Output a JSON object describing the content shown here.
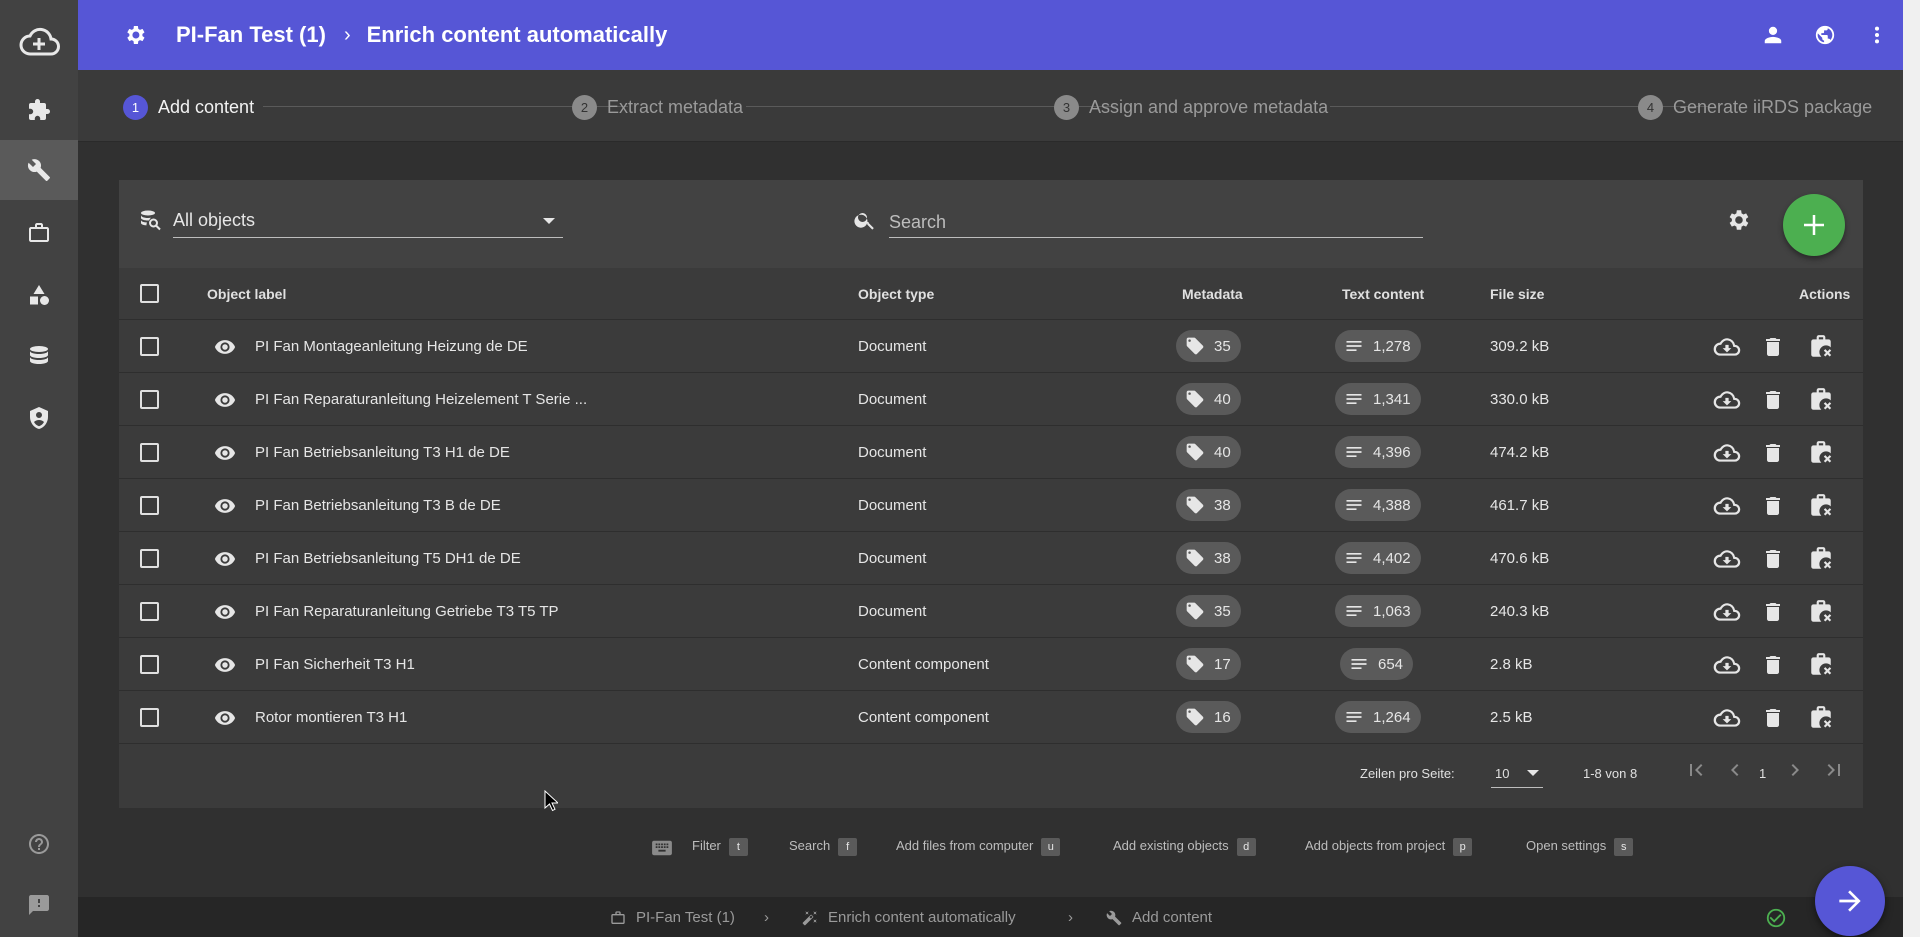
{
  "header": {
    "project": "PI-Fan Test (1)",
    "page": "Enrich content automatically"
  },
  "stepper": [
    {
      "num": "1",
      "label": "Add content",
      "active": true
    },
    {
      "num": "2",
      "label": "Extract metadata",
      "active": false
    },
    {
      "num": "3",
      "label": "Assign and approve metadata",
      "active": false
    },
    {
      "num": "4",
      "label": "Generate iiRDS package",
      "active": false
    }
  ],
  "toolbar": {
    "filter_value": "All objects",
    "search_placeholder": "Search"
  },
  "table": {
    "headers": {
      "label": "Object label",
      "type": "Object type",
      "metadata": "Metadata",
      "text": "Text content",
      "size": "File size",
      "actions": "Actions"
    },
    "rows": [
      {
        "label": "PI Fan Montageanleitung Heizung de DE",
        "type": "Document",
        "metadata": "35",
        "text": "1,278",
        "size": "309.2 kB"
      },
      {
        "label": "PI Fan Reparaturanleitung Heizelement T Serie ...",
        "type": "Document",
        "metadata": "40",
        "text": "1,341",
        "size": "330.0 kB"
      },
      {
        "label": "PI Fan Betriebsanleitung T3 H1 de DE",
        "type": "Document",
        "metadata": "40",
        "text": "4,396",
        "size": "474.2 kB"
      },
      {
        "label": "PI Fan Betriebsanleitung T3 B de DE",
        "type": "Document",
        "metadata": "38",
        "text": "4,388",
        "size": "461.7 kB"
      },
      {
        "label": "PI Fan Betriebsanleitung T5 DH1 de DE",
        "type": "Document",
        "metadata": "38",
        "text": "4,402",
        "size": "470.6 kB"
      },
      {
        "label": "PI Fan Reparaturanleitung Getriebe T3 T5 TP",
        "type": "Document",
        "metadata": "35",
        "text": "1,063",
        "size": "240.3 kB"
      },
      {
        "label": "PI Fan Sicherheit T3 H1",
        "type": "Content component",
        "metadata": "17",
        "text": "654",
        "size": "2.8 kB"
      },
      {
        "label": "Rotor montieren T3 H1",
        "type": "Content component",
        "metadata": "16",
        "text": "1,264",
        "size": "2.5 kB"
      }
    ]
  },
  "pager": {
    "rows_label": "Zeilen pro Seite:",
    "rows_value": "10",
    "range": "1-8 von 8",
    "page": "1"
  },
  "hints": [
    {
      "label": "Filter",
      "key": "t"
    },
    {
      "label": "Search",
      "key": "f"
    },
    {
      "label": "Add files from computer",
      "key": "u"
    },
    {
      "label": "Add existing objects",
      "key": "d"
    },
    {
      "label": "Add objects from project",
      "key": "p"
    },
    {
      "label": "Open settings",
      "key": "s"
    }
  ],
  "statusbar": {
    "project": "PI-Fan Test (1)",
    "page": "Enrich content automatically",
    "step": "Add content"
  },
  "colors": {
    "accent": "#5656d6",
    "add_button": "#4caf50",
    "status_ok": "#4caf50"
  }
}
